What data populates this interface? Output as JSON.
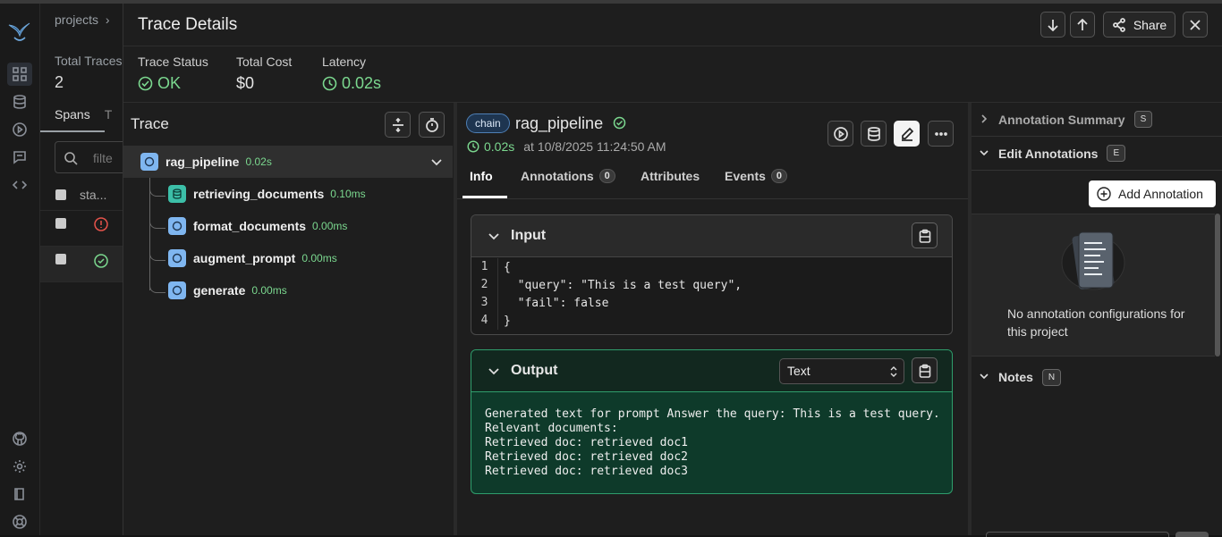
{
  "background": {
    "breadcrumb": "projects",
    "total_traces_label": "Total Traces",
    "total_traces_value": "2",
    "spans_tab": "Spans",
    "partial_tab": "T",
    "filter_placeholder": "filte",
    "status_col": "sta..."
  },
  "dialog": {
    "title": "Trace Details",
    "share_label": "Share"
  },
  "stats": {
    "status_label": "Trace Status",
    "status_value": "OK",
    "cost_label": "Total Cost",
    "cost_value": "$0",
    "latency_label": "Latency",
    "latency_value": "0.02s"
  },
  "tree": {
    "title": "Trace",
    "root": {
      "name": "rag_pipeline",
      "duration": "0.02s"
    },
    "children": [
      {
        "name": "retrieving_documents",
        "duration": "0.10ms",
        "icon": "database-icon"
      },
      {
        "name": "format_documents",
        "duration": "0.00ms",
        "icon": "circle-icon"
      },
      {
        "name": "augment_prompt",
        "duration": "0.00ms",
        "icon": "circle-icon"
      },
      {
        "name": "generate",
        "duration": "0.00ms",
        "icon": "circle-icon"
      }
    ]
  },
  "detail": {
    "kind": "chain",
    "name": "rag_pipeline",
    "latency": "0.02s",
    "timestamp": "at 10/8/2025 11:24:50 AM",
    "tabs": [
      {
        "label": "Info"
      },
      {
        "label": "Annotations",
        "count": "0"
      },
      {
        "label": "Attributes"
      },
      {
        "label": "Events",
        "count": "0"
      }
    ],
    "input_title": "Input",
    "input_lines": [
      "{",
      "  \"query\": \"This is a test query\",",
      "  \"fail\": false",
      "}"
    ],
    "input_line_numbers": [
      "1",
      "2",
      "3",
      "4"
    ],
    "output_title": "Output",
    "output_format": "Text",
    "output_text": "Generated text for prompt Answer the query: This is a test query.\nRelevant documents:\nRetrieved doc: retrieved doc1\nRetrieved doc: retrieved doc2\nRetrieved doc: retrieved doc3"
  },
  "annotations": {
    "summary_label": "Annotation Summary",
    "summary_key": "S",
    "edit_label": "Edit Annotations",
    "edit_key": "E",
    "add_label": "Add Annotation",
    "empty_text": "No annotation configurations for this project",
    "notes_label": "Notes",
    "notes_key": "N"
  }
}
